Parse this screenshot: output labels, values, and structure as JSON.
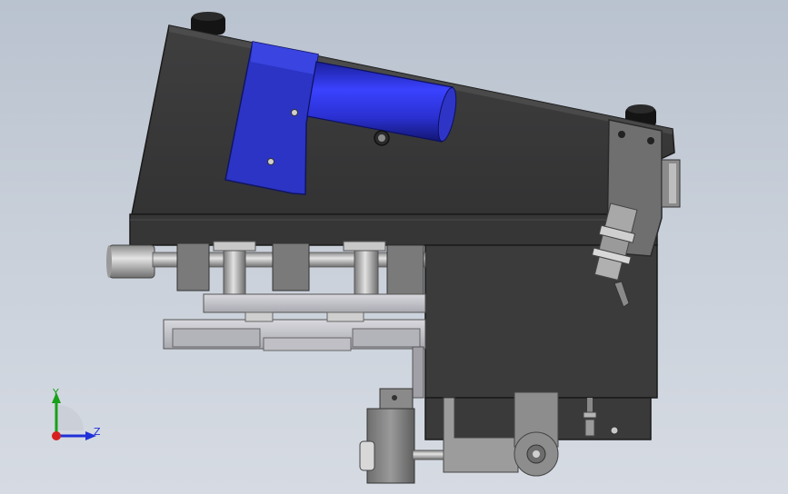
{
  "viewport": {
    "background_top": "#b9c2cf",
    "background_bottom": "#d6dbe3"
  },
  "colors": {
    "body_dark": "#3a3a3a",
    "body_edge": "#1e1e1e",
    "blue_bracket": "#2b34c4",
    "blue_cylinder": "#2a2fd8",
    "steel": "#b8b8b8",
    "steel_dark": "#7d7d7d",
    "plate": "#c9c9cf",
    "axis_x": "#d62020",
    "axis_y": "#18a018",
    "axis_z": "#2030d8"
  },
  "triad": {
    "y_label": "Y",
    "z_label": "Z",
    "x_icon": "x-axis-arrow-icon",
    "y_icon": "y-axis-arrow-icon",
    "z_icon": "z-axis-arrow-icon"
  }
}
